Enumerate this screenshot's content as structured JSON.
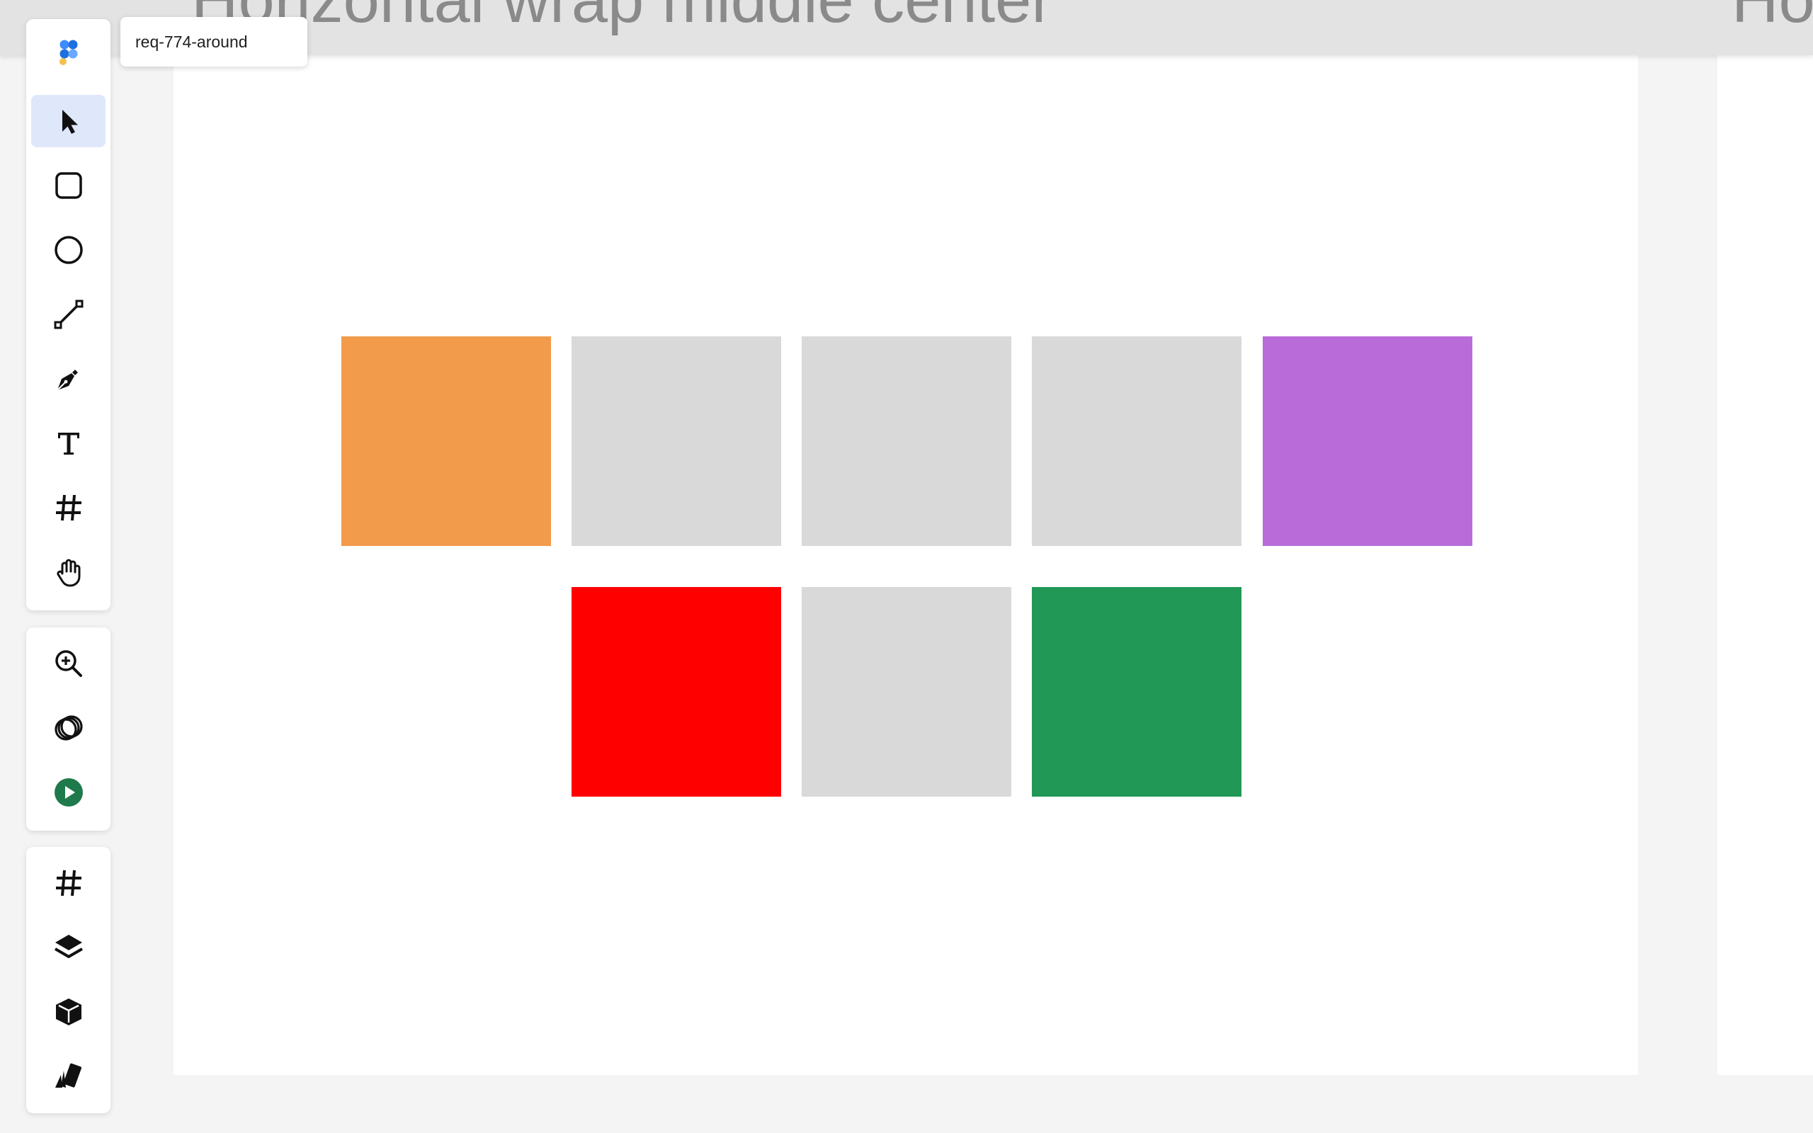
{
  "canvas": {
    "frame_titles": [
      "Horizontal wrap middle center",
      "Ho"
    ],
    "tiles": [
      {
        "name": "orange",
        "color": "#f29b4b"
      },
      {
        "name": "gray",
        "color": "#d9d9d9"
      },
      {
        "name": "gray",
        "color": "#d9d9d9"
      },
      {
        "name": "gray",
        "color": "#d9d9d9"
      },
      {
        "name": "purple",
        "color": "#b96bd9"
      },
      {
        "name": "red",
        "color": "#ff0000"
      },
      {
        "name": "gray",
        "color": "#d9d9d9"
      },
      {
        "name": "green",
        "color": "#219856"
      }
    ]
  },
  "tooltip": {
    "text": "req-774-around"
  },
  "toolbar": {
    "main_tools": [
      {
        "icon": "logo-icon"
      },
      {
        "icon": "pointer-icon",
        "active": true
      },
      {
        "icon": "rectangle-icon"
      },
      {
        "icon": "ellipse-icon"
      },
      {
        "icon": "line-icon"
      },
      {
        "icon": "pen-icon"
      },
      {
        "icon": "text-icon"
      },
      {
        "icon": "frame-hash-icon"
      },
      {
        "icon": "hand-icon"
      }
    ],
    "view_tools": [
      {
        "icon": "zoom-in-icon"
      },
      {
        "icon": "overlap-circles-icon"
      },
      {
        "icon": "play-icon",
        "color": "#1f7a4b"
      }
    ],
    "panel_tools": [
      {
        "icon": "hash-icon"
      },
      {
        "icon": "layers-icon"
      },
      {
        "icon": "cube-icon"
      },
      {
        "icon": "cards-icon"
      }
    ]
  }
}
